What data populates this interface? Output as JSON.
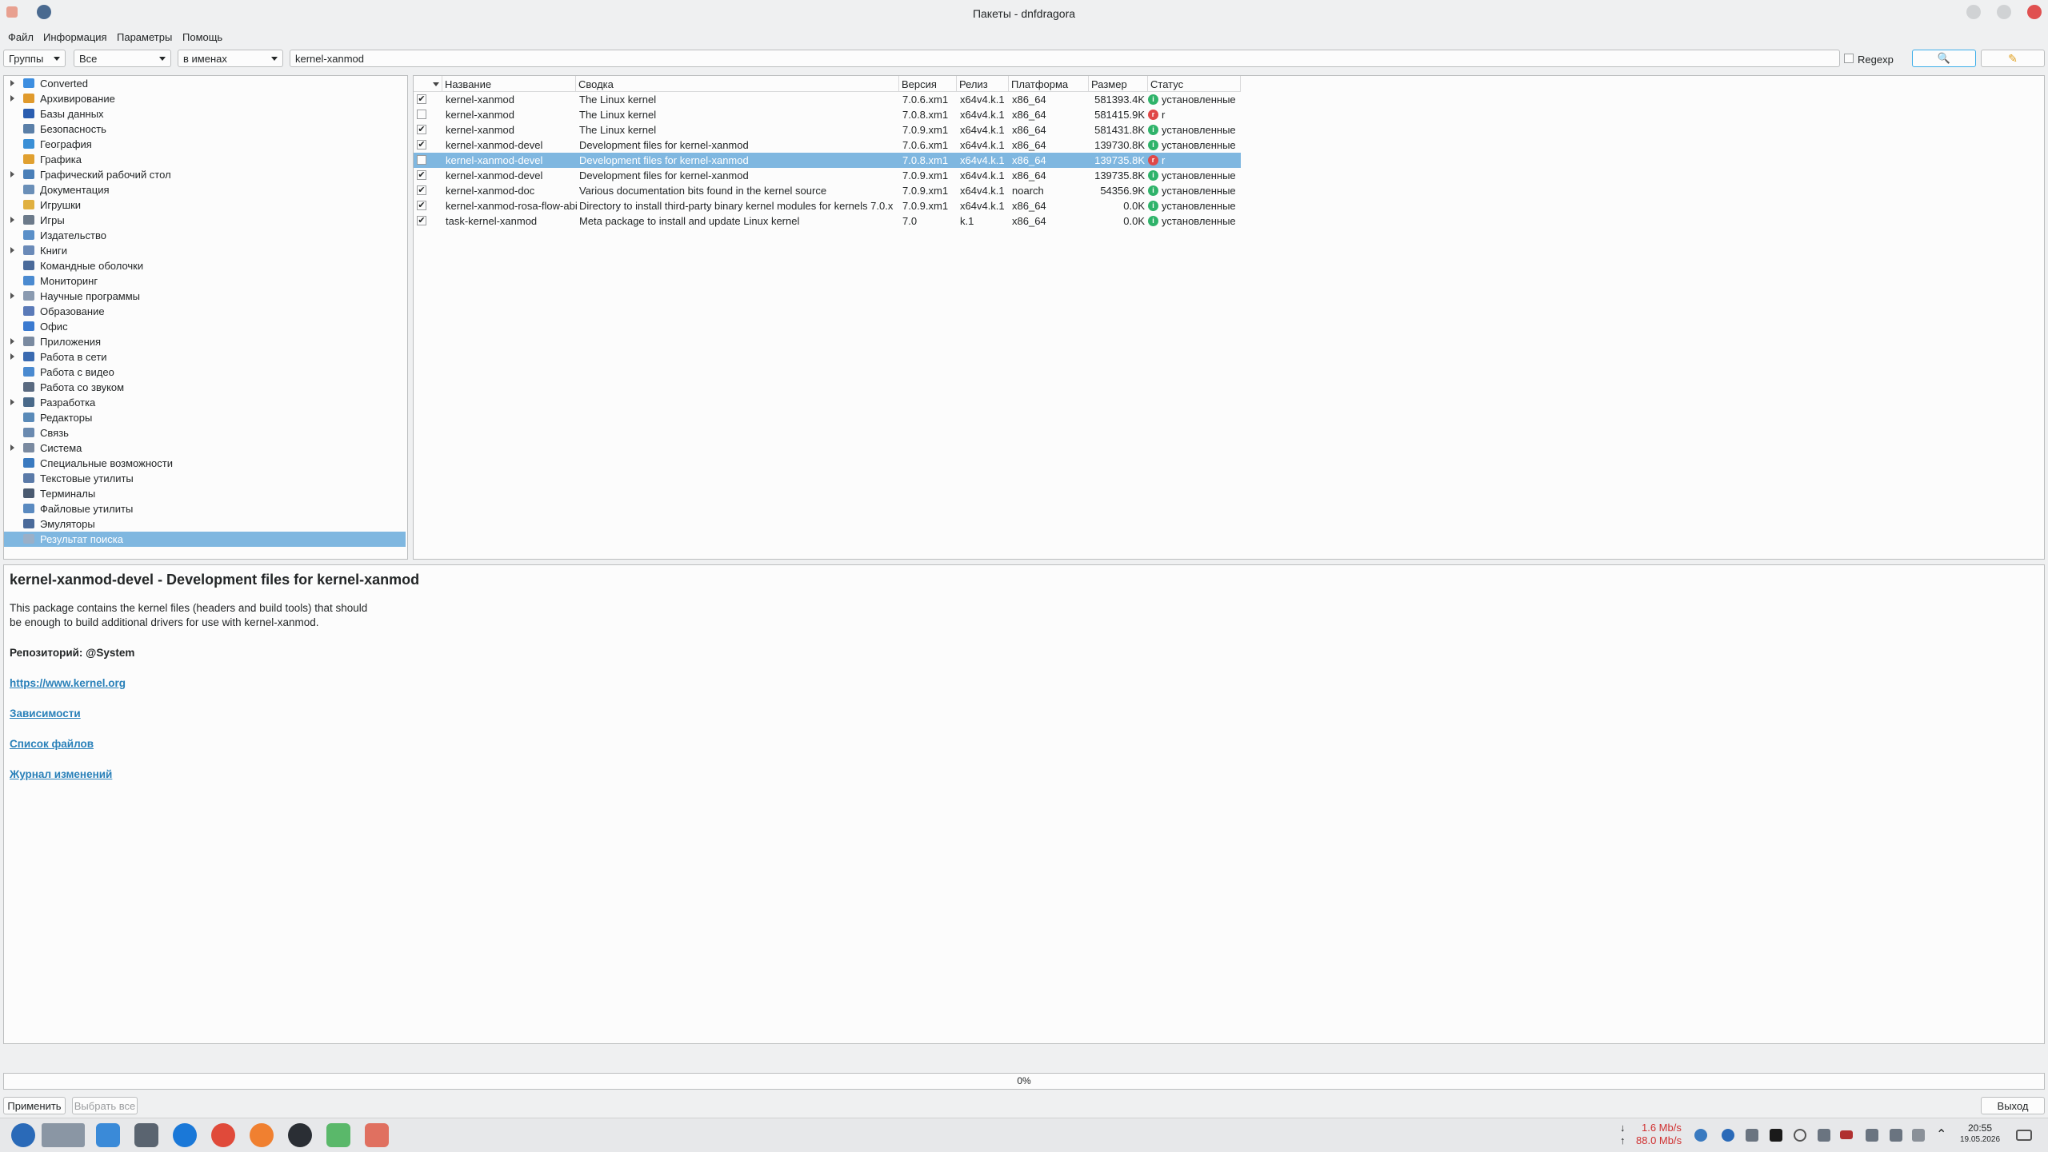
{
  "window": {
    "title": "Пакеты - dnfdragora"
  },
  "menu": [
    "Файл",
    "Информация",
    "Параметры",
    "Помощь"
  ],
  "filters": {
    "group_mode": "Группы",
    "scope": "Все",
    "search_in": "в именах",
    "search_text": "kernel-xanmod",
    "regexp_label": "Regexp"
  },
  "groups": [
    {
      "label": "Converted",
      "exp": true,
      "color": "#3d8ee0"
    },
    {
      "label": "Архивирование",
      "exp": true,
      "color": "#e09a2c"
    },
    {
      "label": "Базы данных",
      "exp": false,
      "color": "#2a5db0"
    },
    {
      "label": "Безопасность",
      "exp": false,
      "color": "#5a7fa8"
    },
    {
      "label": "География",
      "exp": false,
      "color": "#3a8fd6"
    },
    {
      "label": "Графика",
      "exp": false,
      "color": "#e0a030"
    },
    {
      "label": "Графический рабочий стол",
      "exp": true,
      "color": "#4a7fb8"
    },
    {
      "label": "Документация",
      "exp": false,
      "color": "#6a8fb8"
    },
    {
      "label": "Игрушки",
      "exp": false,
      "color": "#e0b040"
    },
    {
      "label": "Игры",
      "exp": true,
      "color": "#6c7a8a"
    },
    {
      "label": "Издательство",
      "exp": false,
      "color": "#5a8fc8"
    },
    {
      "label": "Книги",
      "exp": true,
      "color": "#6a8ab8"
    },
    {
      "label": "Командные оболочки",
      "exp": false,
      "color": "#4a6a9a"
    },
    {
      "label": "Мониторинг",
      "exp": false,
      "color": "#4a8ad0"
    },
    {
      "label": "Научные программы",
      "exp": true,
      "color": "#8a9ab0"
    },
    {
      "label": "Образование",
      "exp": false,
      "color": "#5a7ab8"
    },
    {
      "label": "Офис",
      "exp": false,
      "color": "#3a7ad0"
    },
    {
      "label": "Приложения",
      "exp": true,
      "color": "#7a8aa0"
    },
    {
      "label": "Работа в сети",
      "exp": true,
      "color": "#3a6ab0"
    },
    {
      "label": "Работа с видео",
      "exp": false,
      "color": "#4a8ad0"
    },
    {
      "label": "Работа со звуком",
      "exp": false,
      "color": "#5a6a80"
    },
    {
      "label": "Разработка",
      "exp": true,
      "color": "#4a6a8a"
    },
    {
      "label": "Редакторы",
      "exp": false,
      "color": "#5a8ab8"
    },
    {
      "label": "Связь",
      "exp": false,
      "color": "#6a8ab0"
    },
    {
      "label": "Система",
      "exp": true,
      "color": "#7a8aa0"
    },
    {
      "label": "Специальные возможности",
      "exp": false,
      "color": "#3a7ac0"
    },
    {
      "label": "Текстовые утилиты",
      "exp": false,
      "color": "#5a7aa8"
    },
    {
      "label": "Терминалы",
      "exp": false,
      "color": "#4a5a70"
    },
    {
      "label": "Файловые утилиты",
      "exp": false,
      "color": "#5a8ac0"
    },
    {
      "label": "Эмуляторы",
      "exp": false,
      "color": "#4a6a9a"
    },
    {
      "label": "Результат поиска",
      "exp": false,
      "color": "#9ab0c8",
      "selected": true
    }
  ],
  "table": {
    "headers": [
      "Название",
      "Сводка",
      "Версия",
      "Релиз",
      "Платформа",
      "Размер",
      "Статус"
    ],
    "rows": [
      {
        "checked": true,
        "name": "kernel-xanmod",
        "summary": "The Linux kernel",
        "version": "7.0.6.xm1",
        "release": "x64v4.k.1",
        "arch": "x86_64",
        "size": "581393.4K",
        "state": "i",
        "status": "установленные"
      },
      {
        "checked": false,
        "name": "kernel-xanmod",
        "summary": "The Linux kernel",
        "version": "7.0.8.xm1",
        "release": "x64v4.k.1",
        "arch": "x86_64",
        "size": "581415.9K",
        "state": "r",
        "status": "r"
      },
      {
        "checked": true,
        "name": "kernel-xanmod",
        "summary": "The Linux kernel",
        "version": "7.0.9.xm1",
        "release": "x64v4.k.1",
        "arch": "x86_64",
        "size": "581431.8K",
        "state": "i",
        "status": "установленные"
      },
      {
        "checked": true,
        "name": "kernel-xanmod-devel",
        "summary": "Development files for kernel-xanmod",
        "version": "7.0.6.xm1",
        "release": "x64v4.k.1",
        "arch": "x86_64",
        "size": "139730.8K",
        "state": "i",
        "status": "установленные"
      },
      {
        "checked": false,
        "name": "kernel-xanmod-devel",
        "summary": "Development files for kernel-xanmod",
        "version": "7.0.8.xm1",
        "release": "x64v4.k.1",
        "arch": "x86_64",
        "size": "139735.8K",
        "state": "r",
        "status": "r",
        "selected": true
      },
      {
        "checked": true,
        "name": "kernel-xanmod-devel",
        "summary": "Development files for kernel-xanmod",
        "version": "7.0.9.xm1",
        "release": "x64v4.k.1",
        "arch": "x86_64",
        "size": "139735.8K",
        "state": "i",
        "status": "установленные"
      },
      {
        "checked": true,
        "name": "kernel-xanmod-doc",
        "summary": "Various documentation bits found in the kernel source",
        "version": "7.0.9.xm1",
        "release": "x64v4.k.1",
        "arch": "noarch",
        "size": "54356.9K",
        "state": "i",
        "status": "установленные"
      },
      {
        "checked": true,
        "name": "kernel-xanmod-rosa-flow-abi",
        "summary": "Directory to install third-party binary kernel modules for kernels 7.0.x",
        "version": "7.0.9.xm1",
        "release": "x64v4.k.1",
        "arch": "x86_64",
        "size": "0.0K",
        "state": "i",
        "status": "установленные"
      },
      {
        "checked": true,
        "name": "task-kernel-xanmod",
        "summary": "Meta package to install and update Linux kernel",
        "version": "7.0",
        "release": "k.1",
        "arch": "x86_64",
        "size": "0.0K",
        "state": "i",
        "status": "установленные"
      }
    ]
  },
  "info": {
    "heading": "kernel-xanmod-devel - Development files for kernel-xanmod",
    "desc1": "This package contains the kernel files (headers and build tools) that should",
    "desc2": "be enough to build additional drivers for use with kernel-xanmod.",
    "repo": "Репозиторий: @System",
    "url": "https://www.kernel.org",
    "deps": "Зависимости",
    "files": "Список файлов",
    "changelog": "Журнал изменений"
  },
  "progress": "0%",
  "buttons": {
    "apply": "Применить",
    "select_all": "Выбрать все",
    "quit": "Выход"
  },
  "taskbar": {
    "net_down": "1.6 Mb/s",
    "net_up": "88.0 Mb/s",
    "time": "20:55",
    "date": "19.05.2026"
  },
  "colors": {
    "selection": "#7fb7e0",
    "installed": "#2fb36a",
    "removed": "#e04848",
    "link": "#2980b9"
  }
}
